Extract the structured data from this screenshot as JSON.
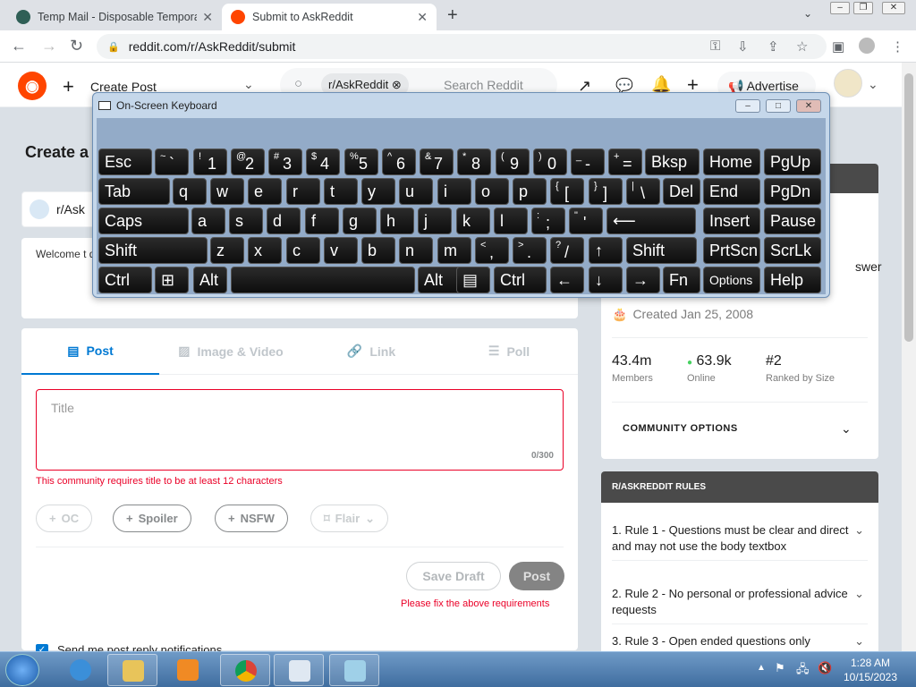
{
  "browser": {
    "tabs": [
      {
        "title": "Temp Mail - Disposable Tempora",
        "favicon_color": "#2f5f56"
      },
      {
        "title": "Submit to AskReddit",
        "favicon_color": "#ff4500"
      }
    ],
    "url": "reddit.com/r/AskReddit/submit"
  },
  "reddit_header": {
    "create_post": "Create Post",
    "community_chip": "r/AskReddit",
    "search_placeholder": "Search Reddit",
    "advertise": "Advertise"
  },
  "page": {
    "title": "Create a",
    "community_selector": "r/Ask",
    "welcome_text": "Welcome t questions, removed. F not allowed can be found in the sidebar.",
    "tabs": [
      "Post",
      "Image & Video",
      "Link",
      "Poll"
    ],
    "title_placeholder": "Title",
    "title_counter": "0/300",
    "title_error": "This community requires title to be at least 12 characters",
    "tags": [
      "OC",
      "Spoiler",
      "NSFW",
      "Flair"
    ],
    "save_draft": "Save Draft",
    "post": "Post",
    "fix_requirements": "Please fix the above requirements",
    "notify_label": "Send me post reply notifications"
  },
  "sidebar": {
    "about_fragment": "swer",
    "created": "Created Jan 25, 2008",
    "stats": [
      {
        "value": "43.4m",
        "label": "Members"
      },
      {
        "value": "63.9k",
        "label": "Online"
      },
      {
        "value": "#2",
        "label": "Ranked by Size"
      }
    ],
    "community_options": "COMMUNITY OPTIONS",
    "rules_title": "R/ASKREDDIT RULES",
    "rules": [
      "1. Rule 1 - Questions must be clear and direct and may not use the body textbox",
      "2. Rule 2 - No personal or professional advice requests",
      "3. Rule 3 - Open ended questions only"
    ]
  },
  "osk": {
    "title": "On-Screen Keyboard",
    "rows": [
      [
        "Esc",
        "~ `",
        "! 1",
        "@ 2",
        "# 3",
        "$ 4",
        "% 5",
        "^ 6",
        "& 7",
        "* 8",
        "( 9",
        ") 0",
        "_ -",
        "+ =",
        "Bksp",
        "Home",
        "PgUp"
      ],
      [
        "Tab",
        "q",
        "w",
        "e",
        "r",
        "t",
        "y",
        "u",
        "i",
        "o",
        "p",
        "{ [",
        "} ]",
        "| \\",
        "Del",
        "End",
        "PgDn"
      ],
      [
        "Caps",
        "a",
        "s",
        "d",
        "f",
        "g",
        "h",
        "j",
        "k",
        "l",
        ": ;",
        "\" '",
        "⟵",
        "Insert",
        "Pause"
      ],
      [
        "Shift",
        "z",
        "x",
        "c",
        "v",
        "b",
        "n",
        "m",
        "< ,",
        "> .",
        "? /",
        "↑",
        "Shift",
        "PrtScn",
        "ScrLk"
      ],
      [
        "Ctrl",
        "⊞",
        "Alt",
        "",
        "Alt",
        "▤",
        "Ctrl",
        "←",
        "↓",
        "→",
        "Fn",
        "Options",
        "Help"
      ]
    ]
  },
  "taskbar": {
    "time": "1:28 AM",
    "date": "10/15/2023"
  }
}
